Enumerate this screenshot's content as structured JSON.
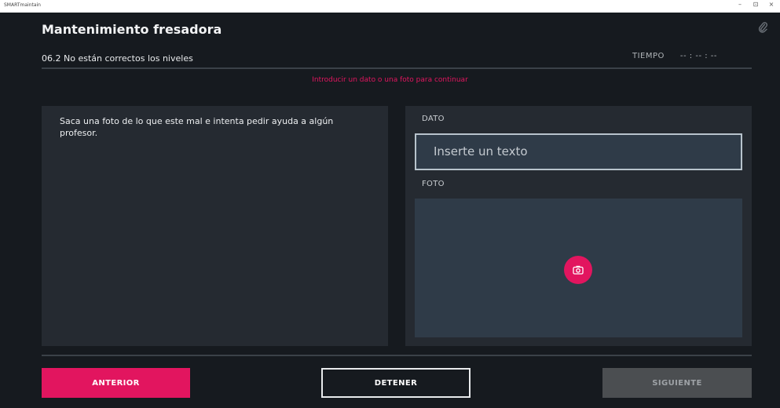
{
  "window": {
    "app_name": "SMARTmaintain",
    "controls": [
      "–",
      "⊡",
      "×"
    ]
  },
  "header": {
    "title": "Mantenimiento fresadora",
    "step_label": "06.2  No están correctos los niveles",
    "time_label": "TIEMPO",
    "time_value": "-- : -- : --"
  },
  "hint": "Introducir un dato o una foto para continuar",
  "instructions": "Saca una foto de lo que este mal e intenta pedir ayuda a algún profesor.",
  "form": {
    "dato_label": "DATO",
    "dato_placeholder": "Inserte un texto",
    "foto_label": "FOTO",
    "camera_icon": "camera-icon"
  },
  "footer": {
    "prev_label": "ANTERIOR",
    "stop_label": "DETENER",
    "next_label": "SIGUIENTE"
  },
  "colors": {
    "accent": "#e2155f",
    "background": "#161a1f",
    "panel": "#252a31",
    "field": "#2f3b48"
  }
}
